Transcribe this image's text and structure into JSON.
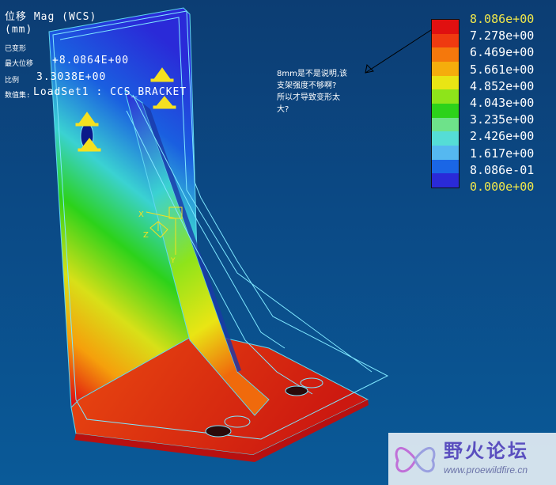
{
  "header": {
    "result_label": "位移 Mag (WCS)",
    "unit_label": "(mm)",
    "deformed_label": "已变形",
    "max_disp_label": "最大位移",
    "max_disp_value": "+8.0864E+00",
    "scale_label": "比例",
    "scale_value": "3.3038E+00",
    "dataset_label": "数值集:",
    "dataset_value": "LoadSet1 : CCS_BRACKET"
  },
  "legend": {
    "labels": [
      "8.086e+00",
      "7.278e+00",
      "6.469e+00",
      "5.661e+00",
      "4.852e+00",
      "4.043e+00",
      "3.235e+00",
      "2.426e+00",
      "1.617e+00",
      "8.086e-01",
      "0.000e+00"
    ],
    "colors": [
      "#e01010",
      "#ef3a10",
      "#f5780c",
      "#f5ad0c",
      "#e9e514",
      "#8ee41a",
      "#2cd21a",
      "#6ee28a",
      "#55ddd6",
      "#55b8f0",
      "#1a66e6",
      "#2a2ad8"
    ],
    "highlight_color": "#f2e84a"
  },
  "annotation": {
    "lines": [
      "8mm是不是说明,该",
      "支架强度不够啊?",
      "所以才导致变形太",
      "大?"
    ]
  },
  "watermark": {
    "title": "野火论坛",
    "url": "www.proewildfire.cn"
  },
  "triad": {
    "x_label": "X",
    "z_label": "Z",
    "y_label": "Y"
  }
}
